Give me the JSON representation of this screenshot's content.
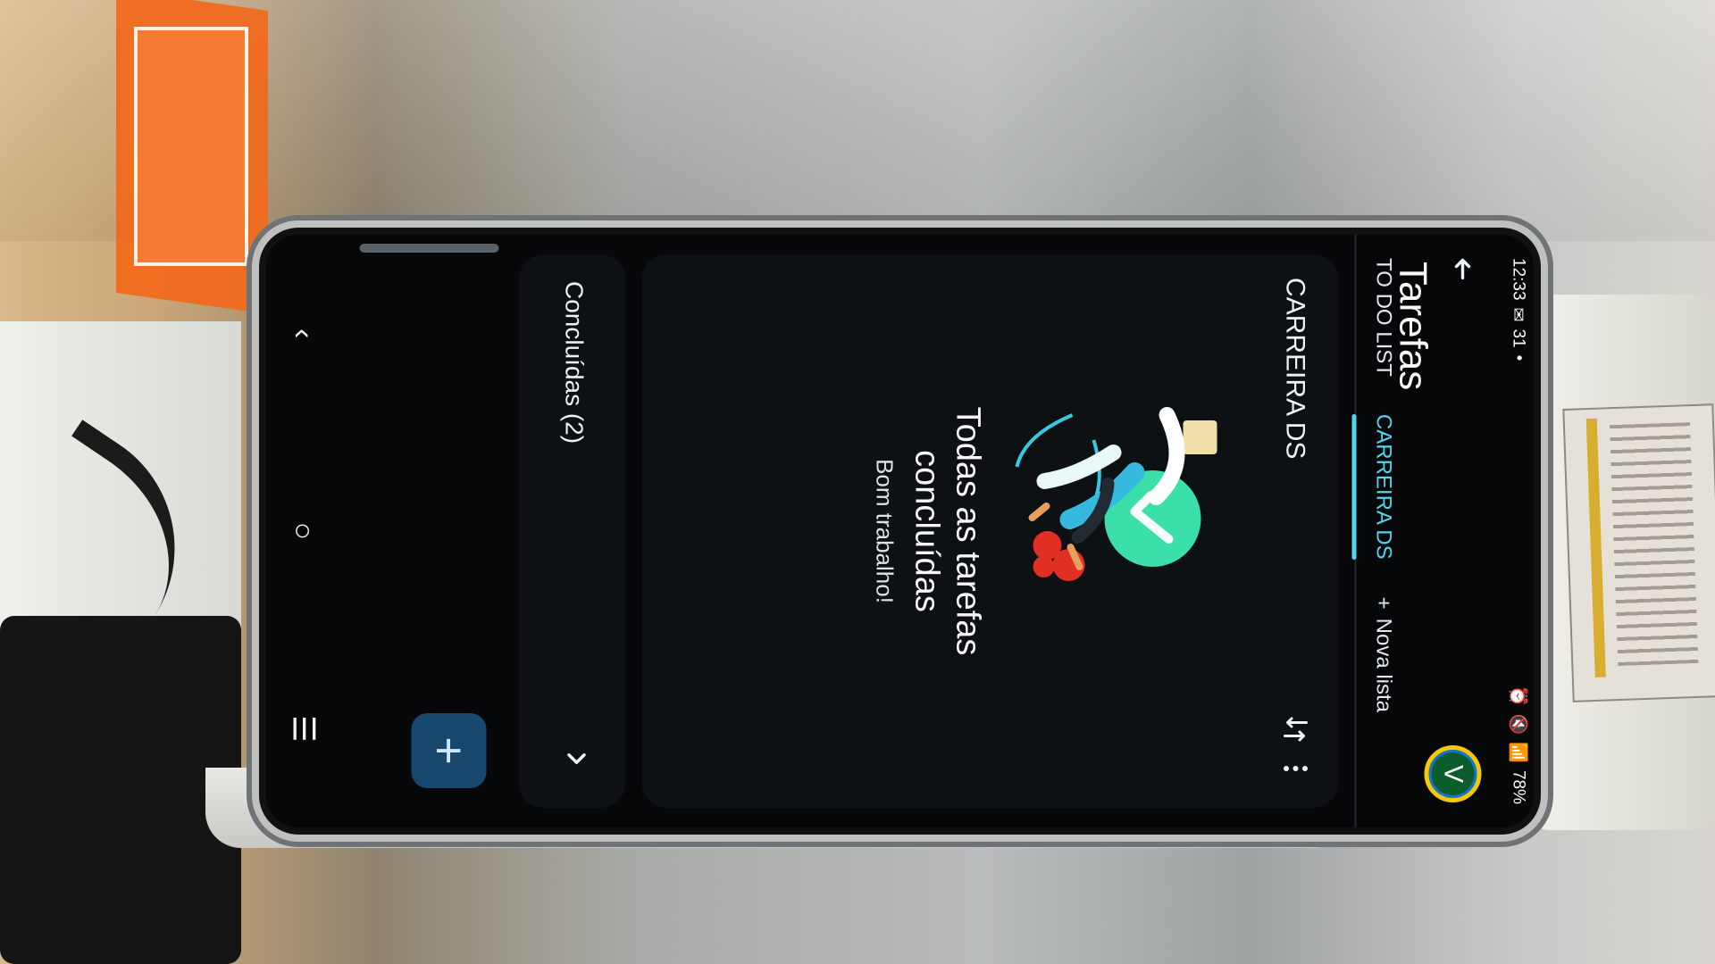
{
  "status": {
    "time": "12:33",
    "battery": "78%"
  },
  "header": {
    "title": "Tarefas",
    "avatar_letter": "V"
  },
  "tabs": [
    {
      "label": "TO DO LIST"
    },
    {
      "label": "CARREIRA DS"
    },
    {
      "label": "Nova lista"
    }
  ],
  "card": {
    "title": "CARREIRA DS",
    "empty_title_line1": "Todas as tarefas",
    "empty_title_line2": "concluídas",
    "empty_subtitle": "Bom trabalho!"
  },
  "completed": {
    "label": "Concluídas (2)"
  },
  "fab": {
    "label": "+"
  },
  "colors": {
    "accent": "#52d6ef",
    "fab": "#19486e"
  }
}
